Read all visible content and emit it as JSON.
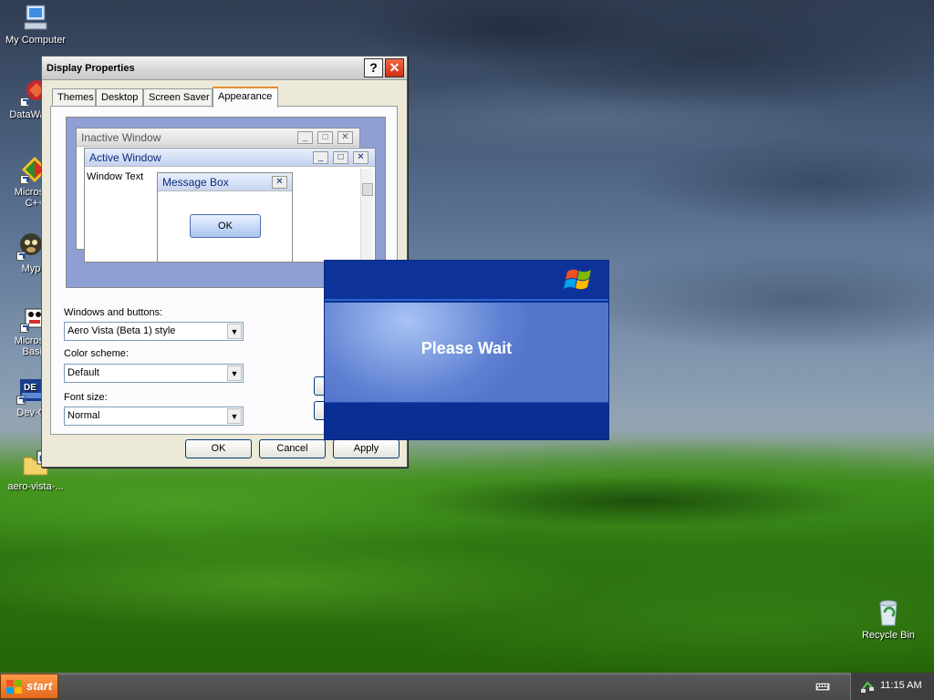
{
  "desktop_icons": [
    {
      "name": "my-computer",
      "label": "My Computer"
    },
    {
      "name": "datawatch",
      "label": "DataWa"
    },
    {
      "name": "microsoft-cpp",
      "label": "Microsoft C++"
    },
    {
      "name": "myp",
      "label": "Myp"
    },
    {
      "name": "microsoft-basic",
      "label": "Microsoft Basic"
    },
    {
      "name": "dev-cpp",
      "label": "Dev-C"
    },
    {
      "name": "aero-vista-folder",
      "label": "aero-vista-..."
    },
    {
      "name": "recycle-bin",
      "label": "Recycle Bin"
    }
  ],
  "dialog": {
    "title": "Display Properties",
    "help": "?",
    "close": "✕",
    "tabs": [
      "Themes",
      "Desktop",
      "Screen Saver",
      "Appearance"
    ],
    "active_tab": "Appearance",
    "preview": {
      "inactive_title": "Inactive Window",
      "active_title": "Active Window",
      "window_text": "Window Text",
      "message_box_title": "Message Box",
      "ok": "OK"
    },
    "windows_buttons_label": "Windows and buttons:",
    "windows_buttons_value": "Aero Vista (Beta 1) style",
    "color_scheme_label": "Color scheme:",
    "color_scheme_value": "Default",
    "font_size_label": "Font size:",
    "font_size_value": "Normal",
    "ok": "OK",
    "cancel": "Cancel",
    "apply": "Apply"
  },
  "splash": {
    "text": "Please Wait"
  },
  "taskbar": {
    "start": "start",
    "clock": "11:15 AM"
  },
  "colors": {
    "title_bar": "#dcdcdc",
    "splash_blue": "#0c3390",
    "start_orange": "#e2681c"
  }
}
